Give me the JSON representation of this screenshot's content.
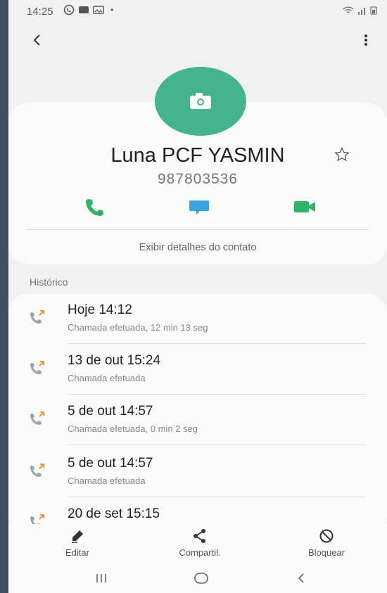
{
  "status_bar": {
    "time": "14:25",
    "notification_icons": [
      "whatsapp-icon",
      "message-icon",
      "gallery-icon"
    ],
    "dot": "•"
  },
  "contact": {
    "name": "Luna PCF YASMIN",
    "number": "987803536",
    "details_link": "Exibir detalhes do contato",
    "avatar_color": "#43b48e"
  },
  "actions": {
    "call_color": "#2db36b",
    "message_color": "#3ba3e0",
    "video_color": "#2db36b"
  },
  "history": {
    "label": "Histórico",
    "calls": [
      {
        "title": "Hoje 14:12",
        "subtitle": "Chamada efetuada, 12 min 13 seg"
      },
      {
        "title": "13 de out 15:24",
        "subtitle": "Chamada efetuada"
      },
      {
        "title": "5 de out 14:57",
        "subtitle": "Chamada efetuada, 0 min 2 seg"
      },
      {
        "title": "5 de out 14:57",
        "subtitle": "Chamada efetuada"
      },
      {
        "title": "20 de set 15:15",
        "subtitle": ""
      }
    ]
  },
  "bottom_bar": {
    "edit": "Editar",
    "share": "Compartil.",
    "block": "Bloquear"
  }
}
